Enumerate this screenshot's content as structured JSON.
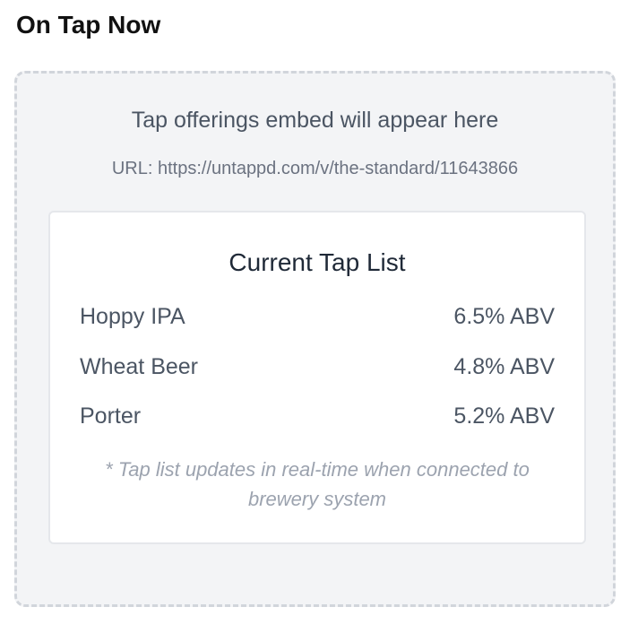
{
  "title": "On Tap Now",
  "placeholder": {
    "message": "Tap offerings embed will appear here",
    "url": "URL: https://untappd.com/v/the-standard/11643866"
  },
  "tap_list": {
    "title": "Current Tap List",
    "items": [
      {
        "name": "Hoppy IPA",
        "abv": "6.5% ABV"
      },
      {
        "name": "Wheat Beer",
        "abv": "4.8% ABV"
      },
      {
        "name": "Porter",
        "abv": "5.2% ABV"
      }
    ],
    "note": "* Tap list updates in real-time when connected to brewery system"
  }
}
